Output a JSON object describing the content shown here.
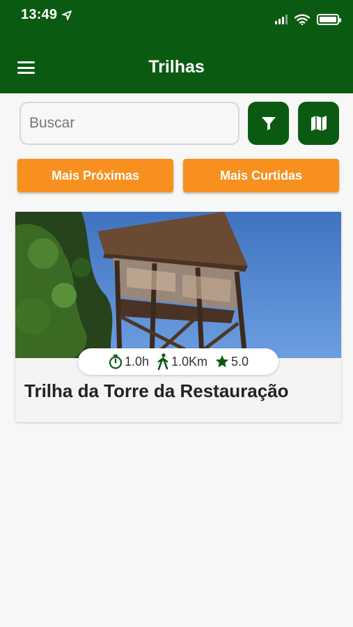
{
  "status_bar": {
    "time": "13:49"
  },
  "header": {
    "title": "Trilhas",
    "menu_icon": "hamburger-menu-icon"
  },
  "search": {
    "placeholder": "Buscar",
    "value": ""
  },
  "buttons": {
    "filter_icon": "filter-icon",
    "map_icon": "map-icon",
    "nearest": "Mais Próximas",
    "most_liked": "Mais Curtidas"
  },
  "trails": [
    {
      "name": "Trilha da Torre da Restauração",
      "duration": "1.0h",
      "distance": "1.0Km",
      "rating": "5.0"
    }
  ],
  "colors": {
    "primary_green": "#0b5a12",
    "accent_orange": "#f7901e",
    "sky_blue": "#3a74c4"
  }
}
